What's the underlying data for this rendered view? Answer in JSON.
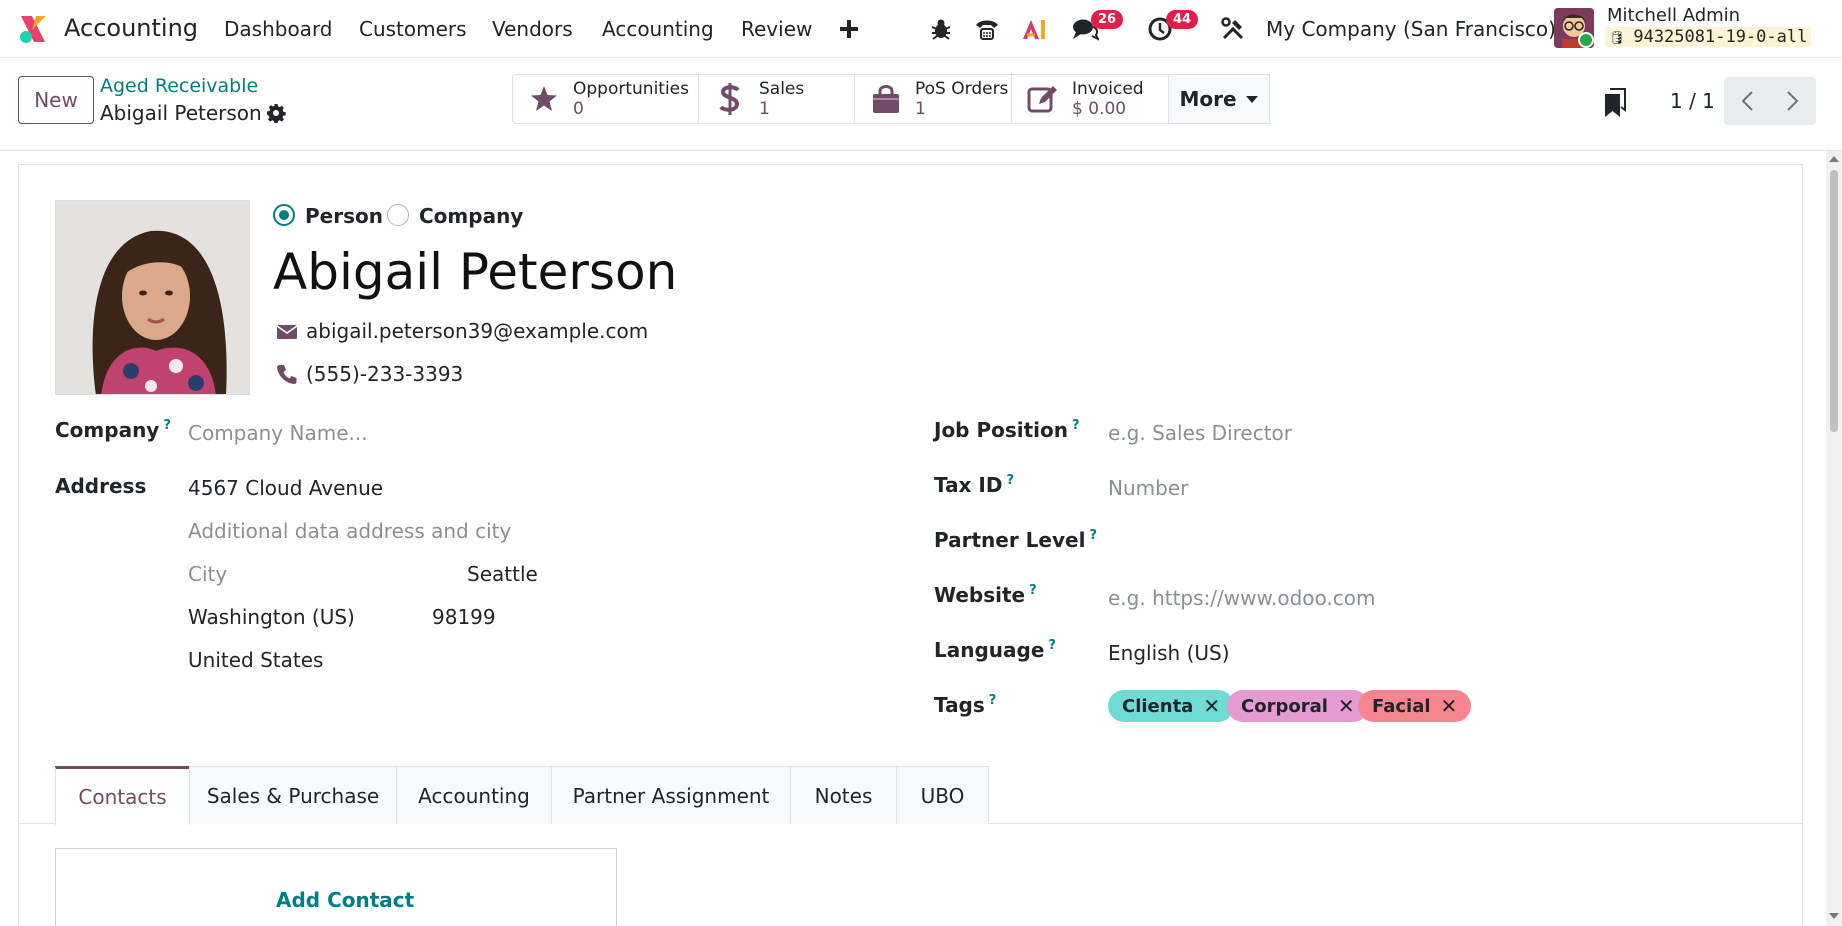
{
  "navbar": {
    "app_name": "Accounting",
    "menu": [
      "Dashboard",
      "Customers",
      "Vendors",
      "Accounting",
      "Review"
    ],
    "messages_count": "26",
    "activities_count": "44",
    "company": "My Company (San Francisco)",
    "user_name": "Mitchell Admin",
    "db_name": "94325081-19-0-all"
  },
  "control_panel": {
    "new_label": "New",
    "breadcrumb_parent": "Aged Receivable",
    "breadcrumb_current": "Abigail Peterson",
    "smart_buttons": [
      {
        "label": "Opportunities",
        "value": "0",
        "icon": "star-icon"
      },
      {
        "label": "Sales",
        "value": "1",
        "icon": "dollar-icon"
      },
      {
        "label": "PoS Orders",
        "value": "1",
        "icon": "shopping-bag-icon"
      },
      {
        "label": "Invoiced",
        "value": "$ 0.00",
        "icon": "pencil-square-icon"
      }
    ],
    "more_label": "More",
    "pager": "1 / 1"
  },
  "form": {
    "type_options": [
      "Person",
      "Company"
    ],
    "type_selected": "Person",
    "name": "Abigail Peterson",
    "email": "abigail.peterson39@example.com",
    "phone": "(555)-233-3393",
    "left_fields": {
      "company_label": "Company",
      "company_placeholder": "Company Name...",
      "address_label": "Address",
      "street": "4567 Cloud Avenue",
      "street2_placeholder": "Additional data address and city",
      "city_placeholder": "City",
      "city": "Seattle",
      "state": "Washington (US)",
      "zip": "98199",
      "country": "United States"
    },
    "right_fields": {
      "job_label": "Job Position",
      "job_placeholder": "e.g. Sales Director",
      "tax_label": "Tax ID",
      "tax_placeholder": "Number",
      "level_label": "Partner Level",
      "website_label": "Website",
      "website_placeholder": "e.g. https://www.odoo.com",
      "language_label": "Language",
      "language": "English (US)",
      "tags_label": "Tags",
      "tags": [
        {
          "label": "Clienta",
          "color": "#6fdcd3"
        },
        {
          "label": "Corporal",
          "color": "#e49bd0"
        },
        {
          "label": "Facial",
          "color": "#f7858f"
        }
      ]
    },
    "help_mark": "?"
  },
  "tabs": [
    "Contacts",
    "Sales & Purchase",
    "Accounting",
    "Partner Assignment",
    "Notes",
    "UBO"
  ],
  "active_tab": "Contacts",
  "add_contact_label": "Add Contact",
  "colors": {
    "brand": "#714b67",
    "accent": "#017e84"
  }
}
